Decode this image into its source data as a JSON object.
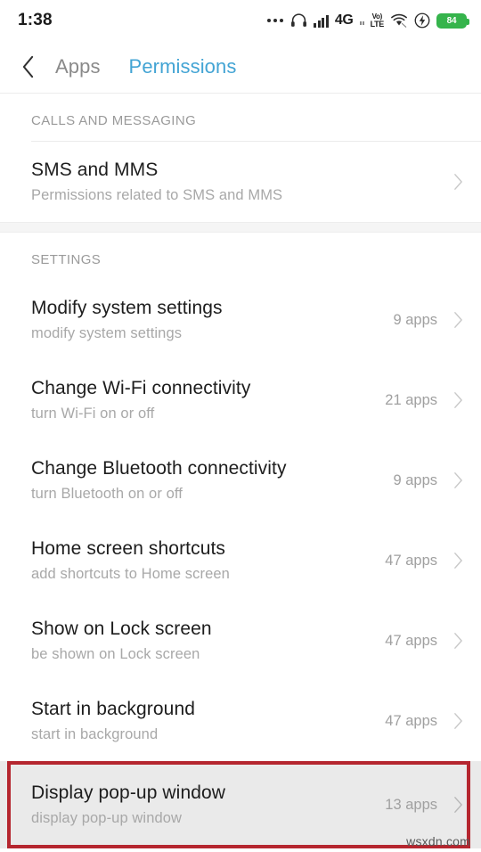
{
  "status_bar": {
    "time": "1:38",
    "network_label": "4G",
    "volte_top": "Vo)",
    "volte_bottom": "LTE",
    "battery_level": "84",
    "icons": [
      "more-dots-icon",
      "headphones-icon",
      "signal-bars-icon",
      "network-4g-label",
      "signal-bars-secondary-icon",
      "volte-icon",
      "wifi-icon",
      "flash-charging-icon",
      "battery-icon"
    ]
  },
  "header": {
    "back_icon": "back-chevron-icon",
    "tabs": [
      {
        "label": "Apps",
        "active": false
      },
      {
        "label": "Permissions",
        "active": true
      }
    ]
  },
  "sections": [
    {
      "label": "CALLS AND MESSAGING",
      "rows": [
        {
          "title": "SMS and MMS",
          "subtitle": "Permissions related to SMS and MMS",
          "count": "",
          "selected": false
        }
      ]
    },
    {
      "label": "SETTINGS",
      "rows": [
        {
          "title": "Modify system settings",
          "subtitle": "modify system settings",
          "count": "9 apps",
          "selected": false
        },
        {
          "title": "Change Wi-Fi connectivity",
          "subtitle": "turn Wi-Fi on or off",
          "count": "21 apps",
          "selected": false
        },
        {
          "title": "Change Bluetooth connectivity",
          "subtitle": "turn Bluetooth on or off",
          "count": "9 apps",
          "selected": false
        },
        {
          "title": "Home screen shortcuts",
          "subtitle": "add shortcuts to Home screen",
          "count": "47 apps",
          "selected": false
        },
        {
          "title": "Show on Lock screen",
          "subtitle": "be shown on Lock screen",
          "count": "47 apps",
          "selected": false
        },
        {
          "title": "Start in background",
          "subtitle": "start in background",
          "count": "47 apps",
          "selected": false
        },
        {
          "title": "Display pop-up window",
          "subtitle": "display pop-up window",
          "count": "13 apps",
          "selected": true
        }
      ]
    }
  ],
  "watermark": "wsxdn.com",
  "colors": {
    "accent": "#43a4d4",
    "highlight_border": "#b5262f",
    "highlight_bg": "#eaeaea",
    "battery_green": "#36b44c"
  }
}
